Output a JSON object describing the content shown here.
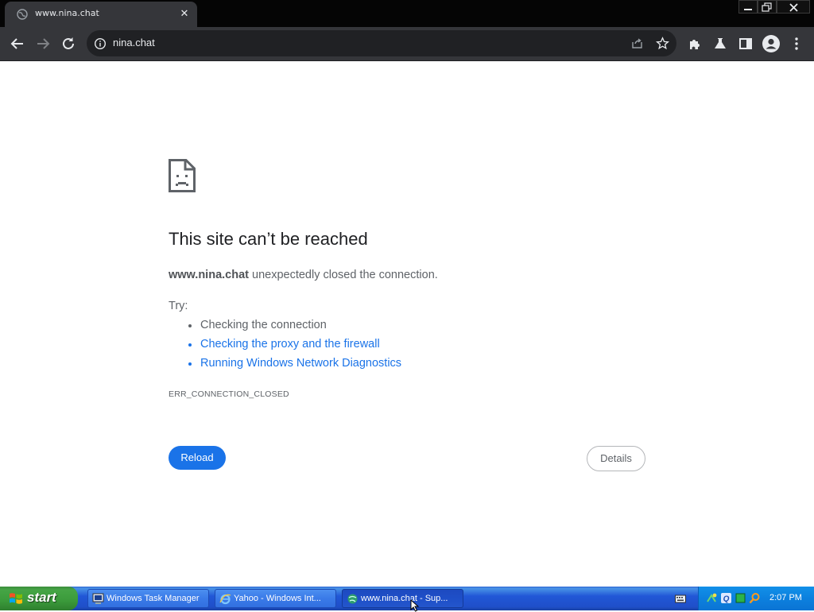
{
  "browser": {
    "tab_title": "www.nina.chat",
    "tab_close": "✕",
    "url": "nina.chat"
  },
  "error": {
    "title": "This site can’t be reached",
    "host": "www.nina.chat",
    "message": " unexpectedly closed the connection.",
    "try_label": "Try:",
    "suggestions": [
      "Checking the connection",
      "Checking the proxy and the firewall",
      "Running Windows Network Diagnostics"
    ],
    "code": "ERR_CONNECTION_CLOSED",
    "reload_label": "Reload",
    "details_label": "Details"
  },
  "taskbar": {
    "start_label": "start",
    "tasks": [
      "Windows Task Manager",
      "Yahoo - Windows Int...",
      "www.nina.chat - Sup..."
    ],
    "clock": "2:07 PM"
  },
  "colors": {
    "link": "#1a73e8",
    "reload_bg": "#1a73e8",
    "taskbar": "#245edb",
    "start": "#3c9a3c"
  }
}
